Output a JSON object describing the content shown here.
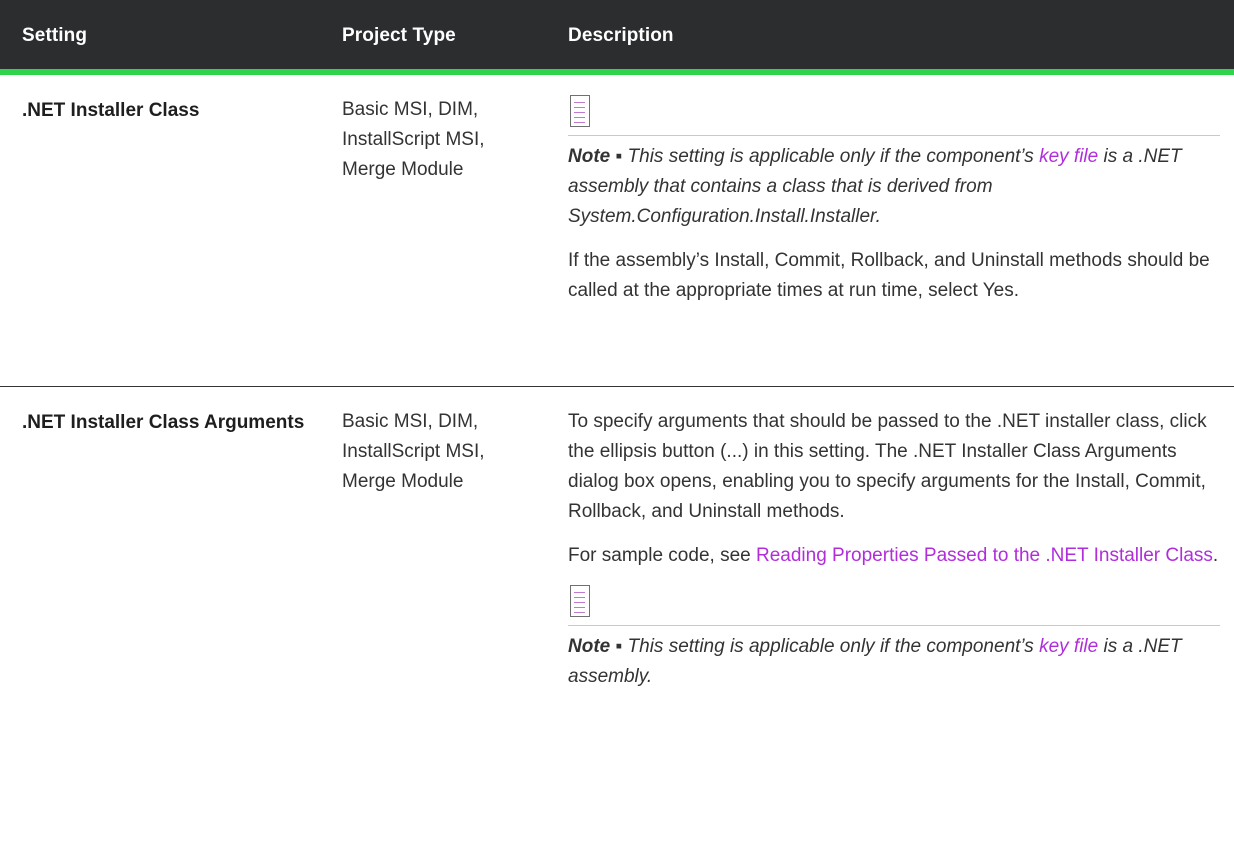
{
  "header": {
    "col1": "Setting",
    "col2": "Project Type",
    "col3": "Description"
  },
  "colors": {
    "header_bg": "#2b2d2f",
    "header_accent": "#2fd34c",
    "link": "#b12ddb"
  },
  "rows": [
    {
      "setting": ".NET Installer Class",
      "project_types": [
        "Basic MSI, DIM,",
        "InstallScript MSI,",
        "Merge Module"
      ],
      "note_icon": "note-icon",
      "note_label": "Note ▪",
      "note_pre": " This setting is applicable only if the component’s ",
      "note_link": "key file",
      "note_post": " is a .NET assembly that contains a class that is derived from System.Configuration.Install.Installer.",
      "desc": "If the assembly’s Install, Commit, Rollback, and Uninstall methods should be called at the appropriate times at run time, select Yes."
    },
    {
      "setting": ".NET Installer Class Arguments",
      "project_types": [
        "Basic MSI, DIM,",
        "InstallScript MSI,",
        "Merge Module"
      ],
      "desc1": "To specify arguments that should be passed to the .NET installer class, click the ellipsis button (...) in this setting. The .NET Installer Class Arguments dialog box opens, enabling you to specify arguments for the Install, Commit, Rollback, and Uninstall methods.",
      "sample_pre": "For sample code, see ",
      "sample_link": "Reading Properties Passed to the .NET Installer Class",
      "sample_post": ".",
      "note_icon": "note-icon",
      "note_label": "Note ▪",
      "note_pre": " This setting is applicable only if the component’s ",
      "note_link": "key file",
      "note_post": " is a .NET assembly."
    }
  ]
}
